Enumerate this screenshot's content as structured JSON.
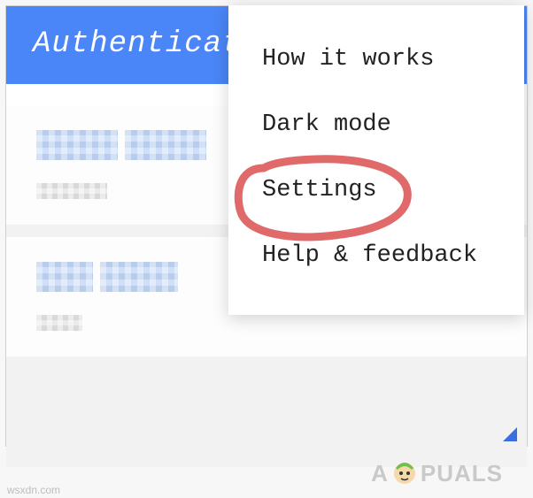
{
  "header": {
    "title": "Authenticator"
  },
  "menu": {
    "items": [
      {
        "label": "How it works"
      },
      {
        "label": "Dark mode"
      },
      {
        "label": "Settings"
      },
      {
        "label": "Help & feedback"
      }
    ],
    "highlighted_index": 2
  },
  "watermark": {
    "prefix": "A",
    "suffix": "PUALS"
  },
  "source": {
    "text": "wsxdn.com"
  }
}
